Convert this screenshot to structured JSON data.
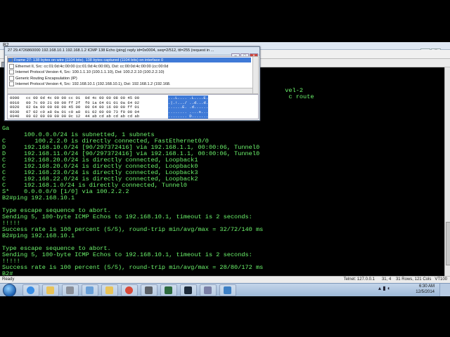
{
  "terminal": {
    "title": "B2",
    "lines": [
      "",
      "",
      "",
      "                                                                              vel-2",
      "                                                                               c route",
      "",
      "",
      "",
      "",
      "Ga",
      "      100.0.0.0/24 is subnetted, 1 subnets",
      "C        100.2.2.0 is directly connected, FastEthernet0/0",
      "D     192.168.10.0/24 [90/297372416] via 192.168.1.1, 00:00:06, Tunnel0",
      "D     192.168.11.0/24 [90/297372416] via 192.168.1.1, 00:00:06, Tunnel0",
      "C     192.168.20.0/24 is directly connected, Loopback1",
      "C     192.168.20.0/24 is directly connected, Loopback0",
      "C     192.168.23.0/24 is directly connected, Loopback3",
      "C     192.168.22.0/24 is directly connected, Loopback2",
      "C     192.168.1.0/24 is directly connected, Tunnel0",
      "S*    0.0.0.0/0 [1/0] via 100.2.2.2",
      "B2#ping 192.168.10.1",
      "",
      "Type escape sequence to abort.",
      "Sending 5, 100-byte ICMP Echos to 192.168.10.1, timeout is 2 seconds:",
      "!!!!!",
      "Success rate is 100 percent (5/5), round-trip min/avg/max = 32/72/140 ms",
      "B2#ping 192.168.10.1",
      "",
      "Type escape sequence to abort.",
      "Sending 5, 100-byte ICMP Echos to 192.168.10.1, timeout is 2 seconds:",
      "!!!!!",
      "Success rate is 100 percent (5/5), round-trip min/avg/max = 28/80/172 ms",
      "B2#"
    ],
    "status_left": "Ready",
    "status_right": "Telnet: 127.0.0.1      31, 4    31 Rows, 121 Cols   VT100"
  },
  "popup": {
    "title": "27 29.4726860000 192.168.10.1 192.168.1.2 ICMP 138 Echo (ping) reply    id=0x0004, seq=2/512, ttl=255 (request in ...",
    "tree": [
      "Frame 27: 138 bytes on wire (1104 bits), 138 bytes captured (1104 bits) on interface 0",
      "Ethernet II, Src: cc:01:0d:4c:00:00 (cc:01:0d:4c:00:00), Dst: cc:00:0d:4c:00:00 (cc:00:0d",
      "Internet Protocol Version 4, Src: 100.1.1.10 (100.1.1.10), Dst: 100.2.2.10 (100.2.2.10)",
      "Generic Routing Encapsulation (IP)",
      "Internet Protocol Version 4, Src: 192.168.10.1 (192.168.10.1), Dst: 192.168.1.2 (192.168."
    ],
    "hex": [
      {
        "off": "0000",
        "bytes": "cc 00 0d 4c 00 00 cc 01  0d 4c 00 00 08 00 45 00",
        "ascii": "...L.... .L....E."
      },
      {
        "off": "0010",
        "bytes": "00 7c 00 21 00 00 ff 2f  f0 1a 64 01 01 0a 64 02",
        "ascii": ".|.!.../ ..d...d."
      },
      {
        "off": "0020",
        "bytes": "02 0a 00 00 08 00 45 00  00 64 00 16 00 00 ff 01",
        "ascii": "......E. .d......"
      },
      {
        "off": "0030",
        "bytes": "07 02 c0 a8 0a 01 c0 a8  01 02 00 00 73 f0 00 04",
        "ascii": "........ ....s..."
      },
      {
        "off": "0040",
        "bytes": "00 02 00 00 00 00 0c 12  44 ab cd ab cd ab cd ab",
        "ascii": "........ D......."
      }
    ]
  },
  "taskbar": {
    "time": "6:30 AM",
    "date": "12/5/2014"
  },
  "colors": {
    "terminal_text": "#6cf46c",
    "selection": "#3f7ad7"
  }
}
